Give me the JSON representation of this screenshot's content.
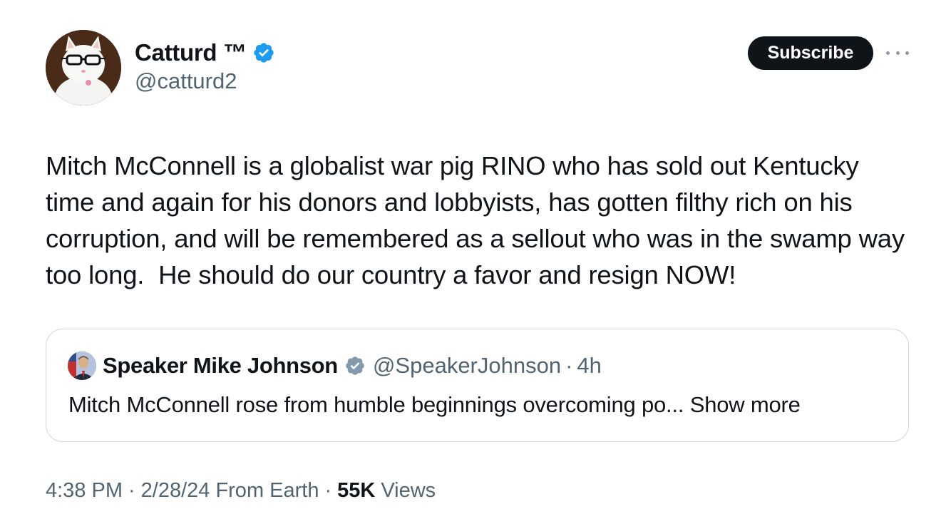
{
  "author": {
    "name": "Catturd ™",
    "handle": "@catturd2",
    "verified": true,
    "avatar_icon": "cat-with-glasses-avatar"
  },
  "subscribe_label": "Subscribe",
  "tweet_text": "Mitch McConnell is a globalist war pig RINO who has sold out Kentucky time and again for his donors and lobbyists, has gotten filthy rich on his corruption, and will be remembered as a sellout who was in the swamp way too long.  He should do our country a favor and resign NOW!",
  "quote": {
    "name": "Speaker Mike Johnson",
    "handle": "@SpeakerJohnson",
    "separator": "·",
    "time": "4h",
    "badge": "gray-verified-badge",
    "text": "Mitch McConnell rose from humble beginnings overcoming po...",
    "show_more": "Show more"
  },
  "meta": {
    "time": "4:38 PM",
    "separator": "·",
    "date": "2/28/24",
    "source": "From Earth",
    "views_count": "55K",
    "views_label": "Views"
  },
  "colors": {
    "text": "#0f1419",
    "secondary": "#536471",
    "verified_blue": "#1d9bf0",
    "border": "#cfd9de"
  }
}
